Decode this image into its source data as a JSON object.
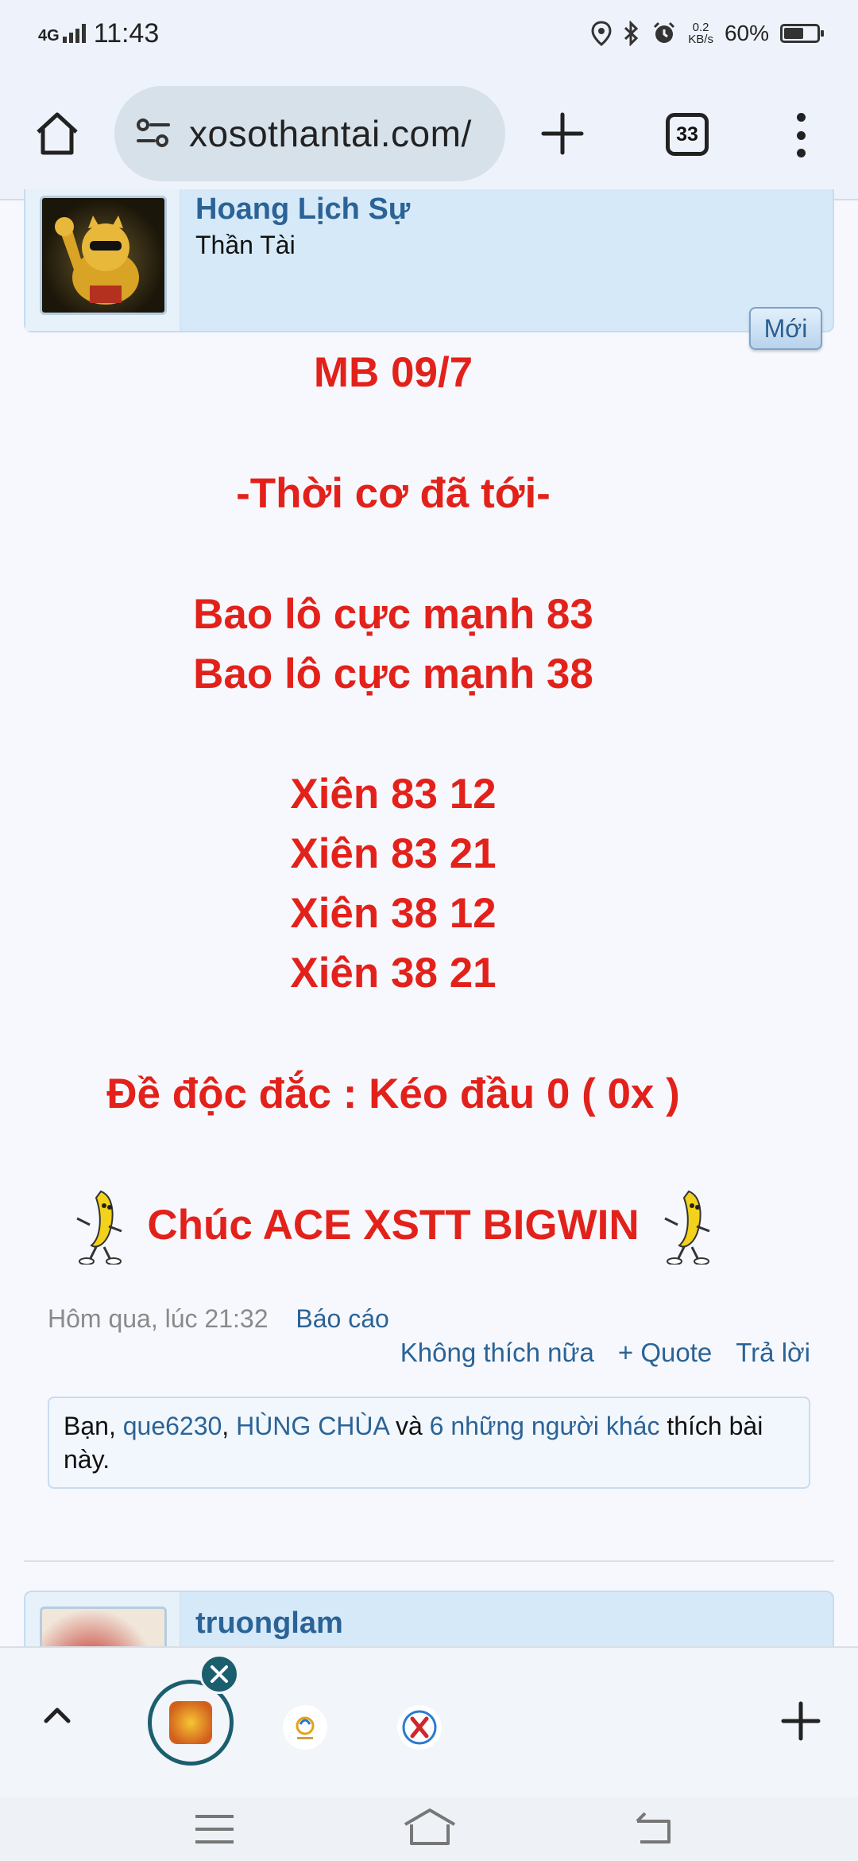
{
  "status_bar": {
    "network": "4G",
    "time": "11:43",
    "speed_value": "0.2",
    "speed_unit": "KB/s",
    "battery": "60%",
    "battery_level": 0.6
  },
  "browser": {
    "url": "xosothantai.com/",
    "tab_count": "33"
  },
  "post": {
    "username": "Hoang Lịch Sự",
    "user_title": "Thần Tài",
    "new_badge": "Mới",
    "lines": {
      "title": "MB 09/7",
      "slogan": "-Thời cơ đã tới-",
      "bao1": "Bao lô cực mạnh 83",
      "bao2": "Bao lô cực mạnh 38",
      "xien1": "Xiên 83 12",
      "xien2": "Xiên 83 21",
      "xien3": "Xiên 38 12",
      "xien4": "Xiên 38 21",
      "de": "Đề độc đắc : Kéo đầu 0 ( 0x )",
      "cheer": "Chúc ACE XSTT BIGWIN"
    },
    "timestamp": "Hôm qua, lúc 21:32",
    "report": "Báo cáo",
    "actions": {
      "unlike": "Không thích nữa",
      "quote": "+ Quote",
      "reply": "Trả lời"
    },
    "likes": {
      "prefix": "Bạn, ",
      "user1": "que6230",
      "sep": ", ",
      "user2": "HÙNG CHÙA",
      "and": " và ",
      "others": "6 những người khác",
      "suffix": " thích bài này."
    }
  },
  "next_post": {
    "username": "truonglam"
  },
  "colors": {
    "post_text": "#e3211b",
    "link": "#2b6396",
    "header_bg": "#d6e9f8"
  }
}
